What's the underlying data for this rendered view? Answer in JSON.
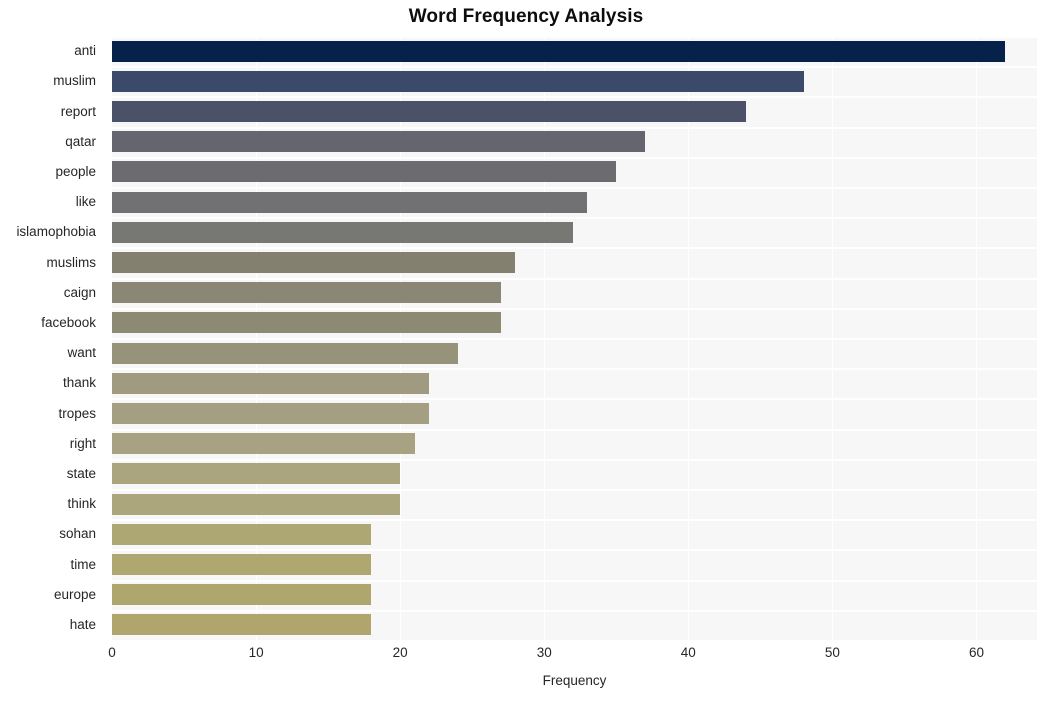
{
  "chart_data": {
    "type": "bar",
    "orientation": "horizontal",
    "title": "Word Frequency Analysis",
    "xlabel": "Frequency",
    "ylabel": "",
    "xlim": [
      0,
      64.2
    ],
    "xticks": [
      0,
      10,
      20,
      30,
      40,
      50,
      60
    ],
    "xtick_labels": [
      "0",
      "10",
      "20",
      "30",
      "40",
      "50",
      "60"
    ],
    "grid": "vertical-and-horizontal-white",
    "legend": "none",
    "categories": [
      "anti",
      "muslim",
      "report",
      "qatar",
      "people",
      "like",
      "islamophobia",
      "muslims",
      "caign",
      "facebook",
      "want",
      "thank",
      "tropes",
      "right",
      "state",
      "think",
      "sohan",
      "time",
      "europe",
      "hate"
    ],
    "values": [
      62,
      48,
      44,
      37,
      35,
      33,
      32,
      28,
      27,
      27,
      24,
      22,
      22,
      21,
      20,
      20,
      18,
      18,
      18,
      18
    ],
    "bar_colors": [
      "#06224a",
      "#3b4a6b",
      "#4b5169",
      "#64656e",
      "#6b6b70",
      "#717173",
      "#777773",
      "#83806f",
      "#8a8776",
      "#8c8a73",
      "#97937b",
      "#a09b80",
      "#a49e82",
      "#a8a283",
      "#aaa47f",
      "#aca67d",
      "#ada873",
      "#aea76f",
      "#afa66e",
      "#b0a56d"
    ],
    "plot_background": "#f7f7f7",
    "figure_background": "#ffffff",
    "title_color": "#0d0d0d",
    "tick_color": "#262626"
  }
}
